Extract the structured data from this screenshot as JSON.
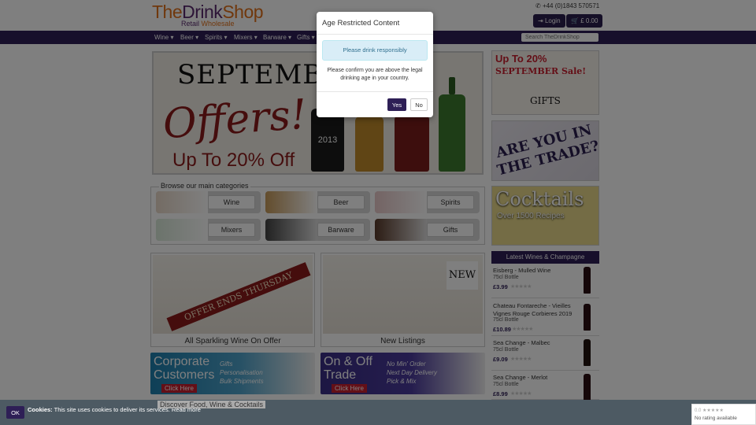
{
  "header": {
    "logo_the": "The",
    "logo_drink": "Drink",
    "logo_shop": "Shop",
    "logo_retail": "Retail",
    "logo_wholesale": "Wholesale",
    "phone": "+44 (0)1843 570571",
    "login_label": "Login",
    "cart_label": "£ 0.00"
  },
  "nav": {
    "items": [
      {
        "label": "Wine ▾"
      },
      {
        "label": "Beer ▾"
      },
      {
        "label": "Spirits ▾"
      },
      {
        "label": "Mixers ▾"
      },
      {
        "label": "Barware ▾"
      },
      {
        "label": "Gifts ▾"
      }
    ],
    "search_placeholder": "Search TheDrinkShop"
  },
  "banner": {
    "line1": "SEPTEMBER",
    "line2": "Offers!",
    "line3": "Up To 20% Off",
    "bottle_label": "2013"
  },
  "categories": {
    "legend": "Browse our main categories",
    "items": [
      {
        "label": "Wine"
      },
      {
        "label": "Beer"
      },
      {
        "label": "Spirits"
      },
      {
        "label": "Mixers"
      },
      {
        "label": "Barware"
      },
      {
        "label": "Gifts"
      }
    ]
  },
  "promos": [
    {
      "caption": "All Sparkling Wine On Offer",
      "ribbon": "OFFER ENDS THURSDAY"
    },
    {
      "caption": "New Listings",
      "ribbon": "NEW"
    }
  ],
  "corporate": {
    "big1": "Corporate",
    "big2": "Customers",
    "small1": "Gifts",
    "small2": "Personalisation",
    "small3": "Bulk Shipments",
    "click": "Click Here"
  },
  "trade": {
    "big1": "On & Off",
    "big2": "Trade",
    "small1": "No Min' Order",
    "small2": "Next Day Delivery",
    "small3": "Pick & Mix",
    "click": "Click Here"
  },
  "sidebar": {
    "sale_line1": "Up To 20%",
    "sale_line2": "SEPTEMBER Sale!",
    "gifts_label": "GIFTS",
    "trade_text": "ARE YOU IN THE TRADE?",
    "cocktails_title": "Cocktails",
    "cocktails_sub": "Over 1500 Recipes",
    "latest_title": "Latest Wines & Champagne",
    "latest": [
      {
        "name": "Eisberg - Mulled Wine",
        "size": "75cl Bottle",
        "price": "£3.99"
      },
      {
        "name": "Chateau Fontareche - Vieilles Vignes Rouge Corbieres 2019",
        "size": "75cl Bottle",
        "price": "£10.89"
      },
      {
        "name": "Sea Change - Malbec",
        "size": "75cl Bottle",
        "price": "£9.09"
      },
      {
        "name": "Sea Change - Merlot",
        "size": "75cl Bottle",
        "price": "£8.99"
      }
    ]
  },
  "modal": {
    "title": "Age Restricted Content",
    "alert": "Please drink responsibly",
    "text": "Please confirm you are above the legal drinking age in your country.",
    "yes_label": "Yes",
    "no_label": "No"
  },
  "cookie": {
    "ok_label": "OK",
    "bold": "Cookies:",
    "text": " This site uses cookies to deliver its services.",
    "read_more": "Read more",
    "discover": "Discover Food, Wine & Cocktails"
  },
  "rating": {
    "score": "0.0 ★★★★★",
    "text": "No rating available"
  },
  "colors": {
    "brand_purple": "#2e1f56",
    "brand_orange": "#e0701a",
    "alert_bg": "#d9edf7"
  }
}
